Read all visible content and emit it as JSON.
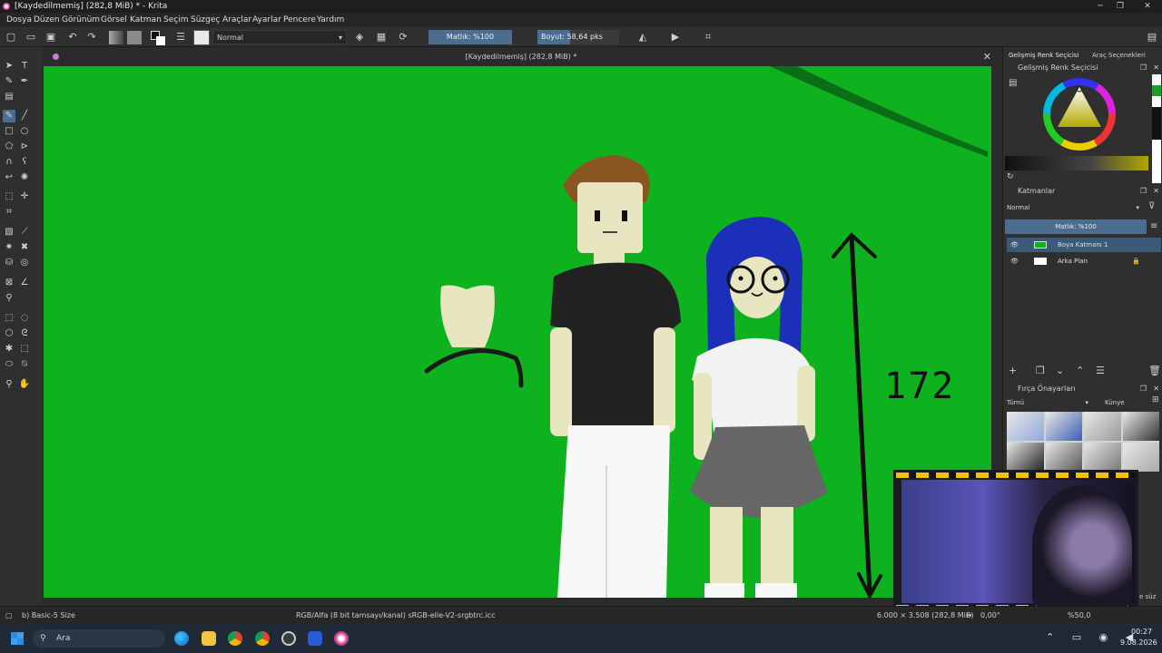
{
  "window": {
    "title": "[Kaydedilmemiş]  (282,8 MiB) * - Krita"
  },
  "menu": [
    "Dosya",
    "Düzen",
    "Görünüm",
    "Görsel",
    "Katman",
    "Seçim",
    "Süzgeç",
    "Araçlar",
    "Ayarlar",
    "Pencere",
    "Yardım"
  ],
  "toolbar": {
    "blend_mode": "Normal",
    "opacity": "Matlık: %100",
    "size": "Boyut: 58,64 pks"
  },
  "document": {
    "tab_title": "[Kaydedilmemiş]  (282,8 MiB) *"
  },
  "canvas": {
    "height_label": "172",
    "bg_color": "#0eb21e"
  },
  "right_dock": {
    "tab_color_selector": "Gelişmiş Renk Seçicisi",
    "tab_tool_options": "Araç Seçenekleri",
    "color_selector_title": "Gelişmiş Renk Seçicisi",
    "layers_title": "Katmanlar",
    "layers_blend": "Normal",
    "layers_opacity": "Matlık: %100",
    "layers": [
      {
        "name": "Boya Katmanı 1",
        "selected": true
      },
      {
        "name": "Arka Plan",
        "selected": false
      }
    ],
    "brush_presets_title": "Fırça Önayarları",
    "brush_filter": "Tümü",
    "brush_tag": "Künye",
    "brush_search": "e süz"
  },
  "status": {
    "brush": "b) Basic-5 Size",
    "color_profile": "RGB/Alfa (8 bit tamsayı/kanal) sRGB-elle-V2-srgbtrc.icc",
    "dimensions": "6.000 × 3.508 (282,8 MiB)",
    "rotation": "0,00°",
    "zoom": "%50,0"
  },
  "taskbar": {
    "search_label": "Ara",
    "time": "00:27",
    "date": "9.08.2026"
  }
}
